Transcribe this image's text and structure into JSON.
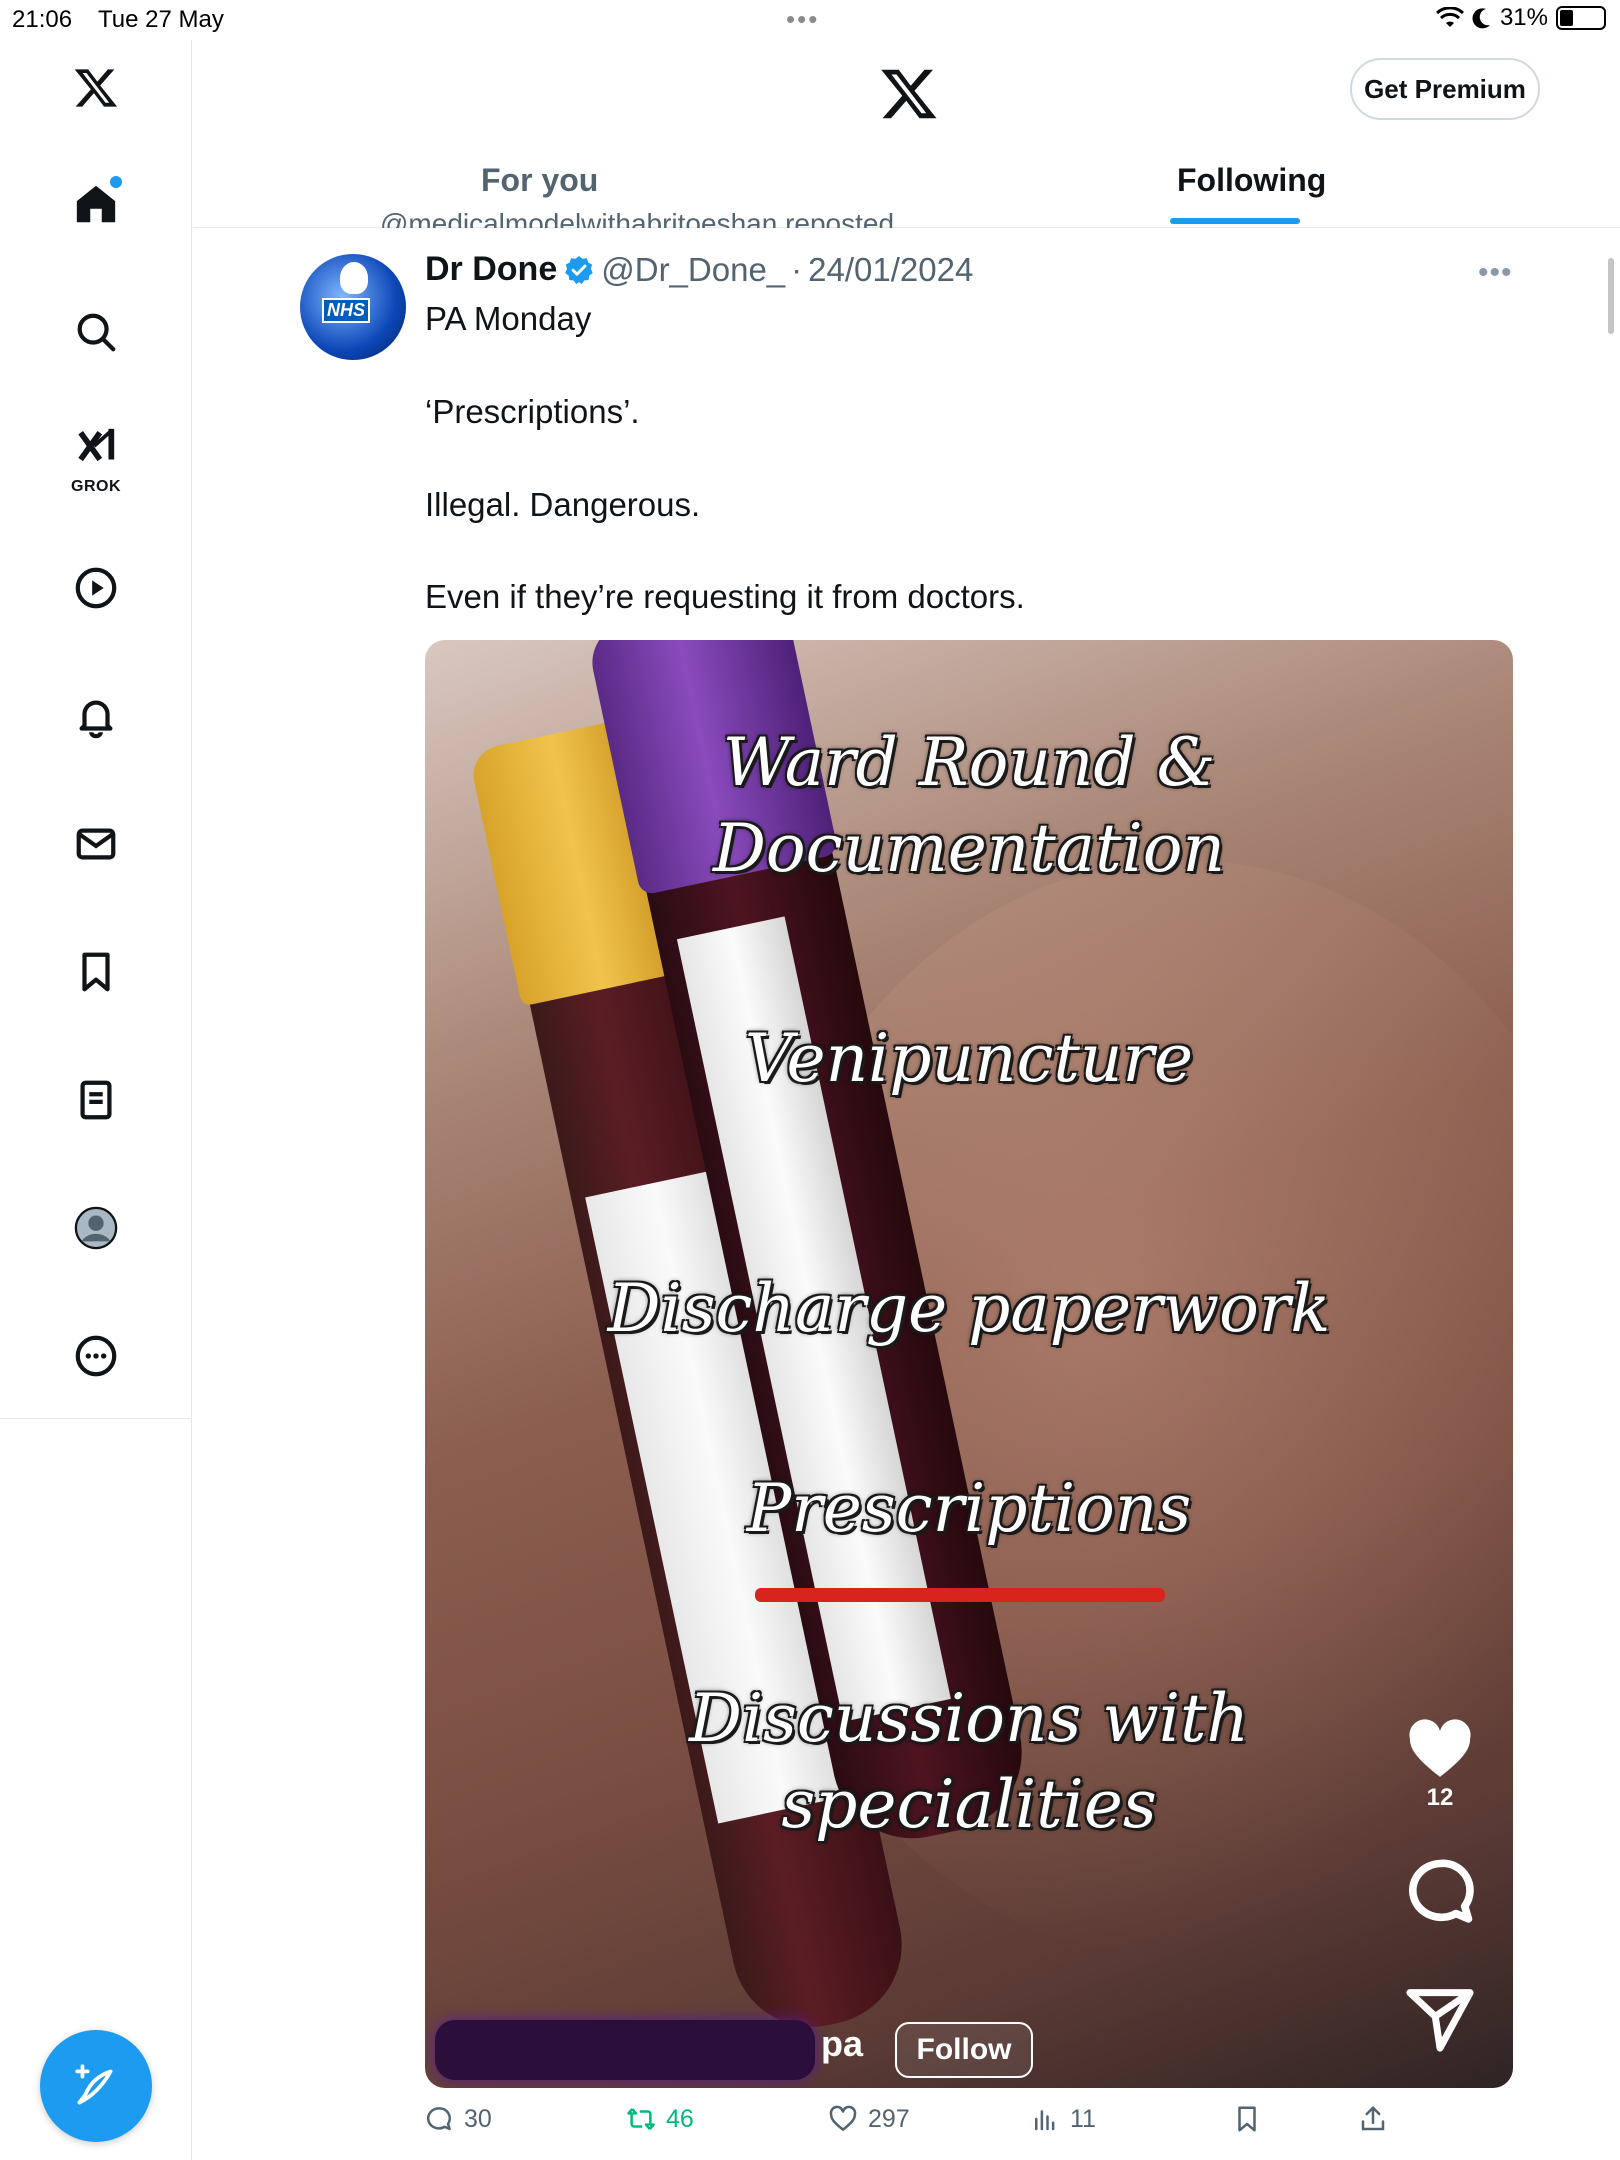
{
  "status_bar": {
    "time": "21:06",
    "date": "Tue 27 May",
    "battery": "31%",
    "battery_level": 0.31,
    "multitask_dots": "•••"
  },
  "sidebar": {
    "items": [
      {
        "name": "home",
        "icon": "home-icon",
        "active": true
      },
      {
        "name": "explore",
        "icon": "search-icon"
      },
      {
        "name": "grok",
        "icon": "grok-icon",
        "label": "GROK"
      },
      {
        "name": "video",
        "icon": "play-icon"
      },
      {
        "name": "notifications",
        "icon": "bell-icon"
      },
      {
        "name": "messages",
        "icon": "mail-icon"
      },
      {
        "name": "bookmarks",
        "icon": "bookmark-icon"
      },
      {
        "name": "lists",
        "icon": "list-icon"
      },
      {
        "name": "profile",
        "icon": "avatar-icon"
      },
      {
        "name": "more",
        "icon": "more-icon"
      }
    ],
    "compose_icon": "compose-icon"
  },
  "header": {
    "premium_label": "Get Premium",
    "tabs": [
      {
        "label": "For you",
        "active": false
      },
      {
        "label": "Following",
        "active": true
      }
    ]
  },
  "tweet": {
    "repost_text": "@medicalmodelwithabritoeshan reposted",
    "author_name": "Dr Done",
    "handle": "@Dr_Done_",
    "separator": "·",
    "date": "24/01/2024",
    "verified": true,
    "more_label": "•••",
    "avatar_text": "NHS",
    "lines": [
      "PA Monday",
      "‘Prescriptions’.",
      "Illegal. Dangerous.",
      "Even if they’re requesting it from doctors."
    ],
    "media": {
      "overlay_lines": [
        "Ward Round &",
        "Documentation",
        "Venipuncture",
        "Discharge paperwork",
        "Prescriptions",
        "Discussions with",
        "specialities"
      ],
      "like_count": "12",
      "username_suffix": "pa",
      "follow_label": "Follow"
    },
    "stats": {
      "replies": "30",
      "reposts": "46",
      "likes": "297",
      "views": "11"
    }
  }
}
